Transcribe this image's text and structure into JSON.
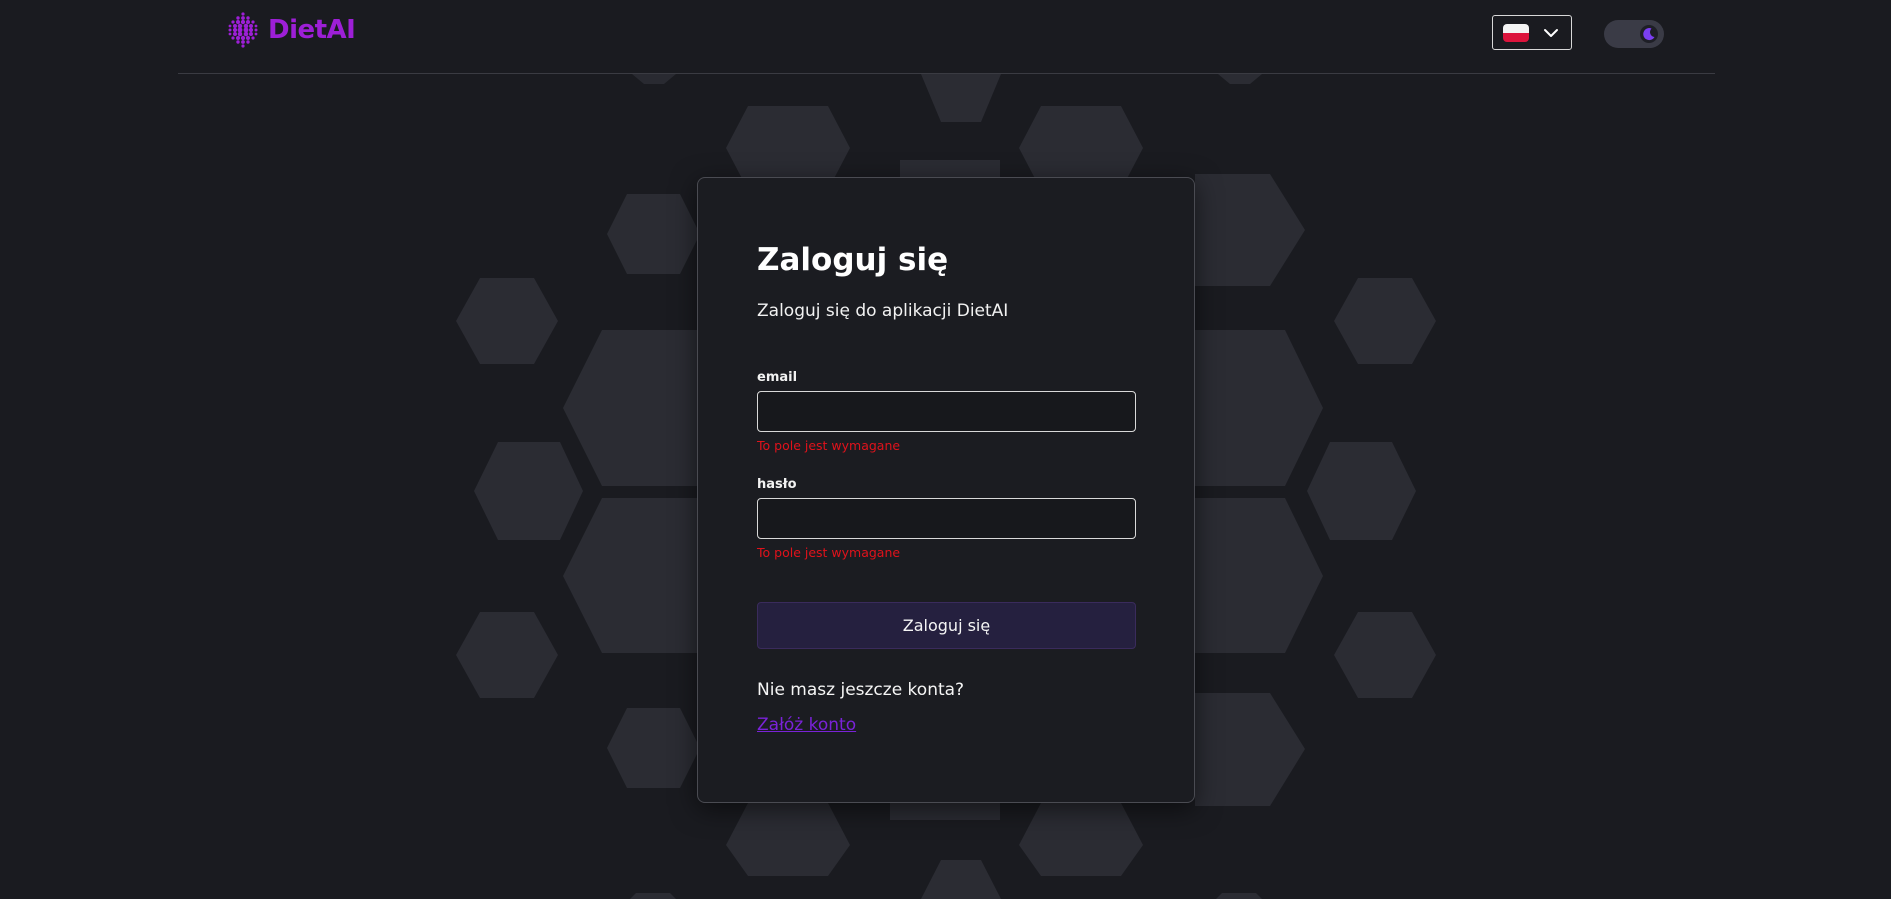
{
  "header": {
    "brand_name": "DietAI",
    "language": {
      "selected_flag": "pl-flag-icon",
      "dropdown_icon": "chevron-down-icon"
    },
    "theme_toggle": {
      "mode": "dark",
      "icon": "moon-icon"
    }
  },
  "login": {
    "title": "Zaloguj się",
    "subtitle": "Zaloguj się do aplikacji DietAI",
    "email": {
      "label": "email",
      "value": "",
      "error": "To pole jest wymagane"
    },
    "password": {
      "label": "hasło",
      "value": "",
      "error": "To pole jest wymagane"
    },
    "submit_label": "Zaloguj się",
    "no_account_text": "Nie masz jeszcze konta?",
    "register_link": "Załóż konto"
  },
  "colors": {
    "background": "#1a1b20",
    "brand": "#9d1fd6",
    "accent_link": "#7a22d8",
    "error": "#e0121b",
    "hexagon": "#2b2c33"
  }
}
